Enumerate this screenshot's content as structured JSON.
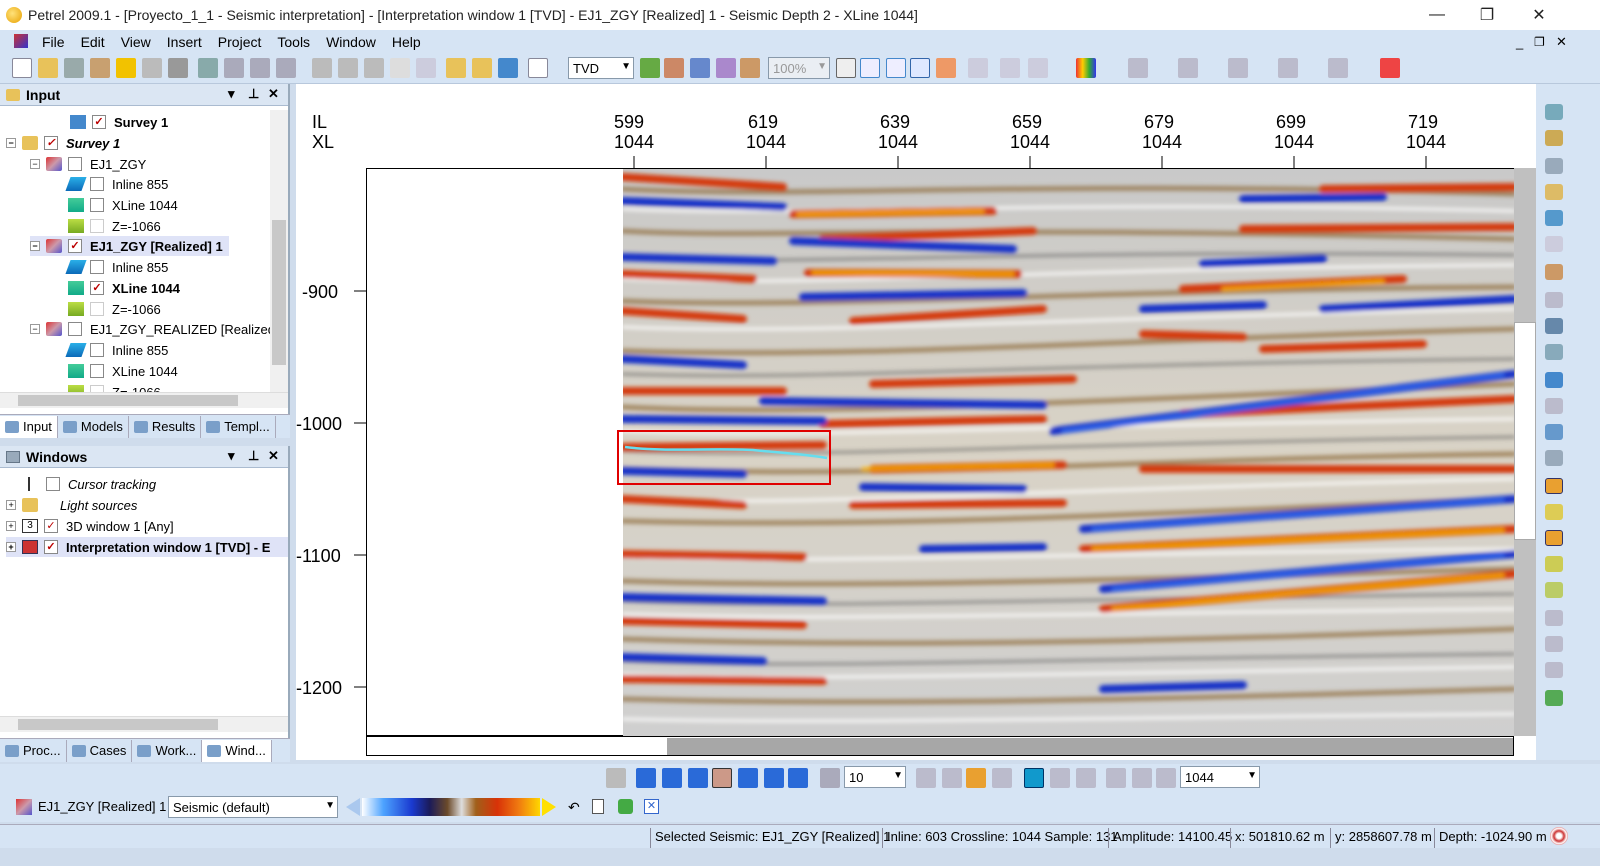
{
  "window": {
    "title": "Petrel 2009.1 - [Proyecto_1_1 - Seismic interpretation] - [Interpretation window 1 [TVD] - EJ1_ZGY [Realized] 1 - Seismic Depth 2 - XLine 1044]",
    "minimize": "—",
    "restore": "❐",
    "close": "✕"
  },
  "menu": [
    "File",
    "Edit",
    "View",
    "Insert",
    "Project",
    "Tools",
    "Window",
    "Help"
  ],
  "toolbar": {
    "domain_select": "TVD",
    "zoom": "100%"
  },
  "input_panel": {
    "title": "Input",
    "tree": [
      {
        "label": "Survey 1",
        "checked": true,
        "bold": true
      },
      {
        "label": "Survey 1",
        "checked": true,
        "bold": true,
        "italic": true
      },
      {
        "label": "EJ1_ZGY",
        "checked": false
      },
      {
        "label": "Inline 855",
        "checked": false
      },
      {
        "label": "XLine 1044",
        "checked": false
      },
      {
        "label": "Z=-1066",
        "checked": false
      },
      {
        "label": "EJ1_ZGY [Realized] 1",
        "checked": true,
        "bold": true
      },
      {
        "label": "Inline 855",
        "checked": false
      },
      {
        "label": "XLine 1044",
        "checked": true,
        "bold": true
      },
      {
        "label": "Z=-1066",
        "checked": false
      },
      {
        "label": "EJ1_ZGY_REALIZED [Realized",
        "checked": false
      },
      {
        "label": "Inline 855",
        "checked": false
      },
      {
        "label": "XLine 1044",
        "checked": false
      },
      {
        "label": "Z=-1066",
        "checked": false
      }
    ],
    "tabs": [
      "Input",
      "Models",
      "Results",
      "Templ..."
    ]
  },
  "windows_panel": {
    "title": "Windows",
    "items": [
      {
        "label": "Cursor tracking",
        "checked": false,
        "italic": true
      },
      {
        "label": "Light sources",
        "italic": true
      },
      {
        "label": "3D window 1 [Any]",
        "checked": true
      },
      {
        "label": "Interpretation window 1 [TVD] - E",
        "checked": true,
        "bold": true
      }
    ],
    "tabs": [
      "Proc...",
      "Cases",
      "Work...",
      "Wind..."
    ]
  },
  "viewport": {
    "axis_il": "IL",
    "axis_xl": "XL",
    "top_ticks": [
      {
        "il": "599",
        "xl": "1044"
      },
      {
        "il": "619",
        "xl": "1044"
      },
      {
        "il": "639",
        "xl": "1044"
      },
      {
        "il": "659",
        "xl": "1044"
      },
      {
        "il": "679",
        "xl": "1044"
      },
      {
        "il": "699",
        "xl": "1044"
      },
      {
        "il": "719",
        "xl": "1044"
      }
    ],
    "depth_ticks": [
      "-900",
      "-1000",
      "-1100",
      "-1200"
    ]
  },
  "playbar": {
    "step": "10",
    "line": "1044"
  },
  "colorbar": {
    "object": "EJ1_ZGY [Realized] 1",
    "template": "Seismic (default)"
  },
  "status": {
    "selected": "Selected Seismic: EJ1_ZGY [Realized] 1",
    "position": "Inline: 603 Crossline: 1044 Sample: 131",
    "amplitude": "Amplitude: 14100.45",
    "x": "x: 501810.62 m",
    "y": "y: 2858607.78 m",
    "depth": "Depth: -1024.90 m"
  }
}
